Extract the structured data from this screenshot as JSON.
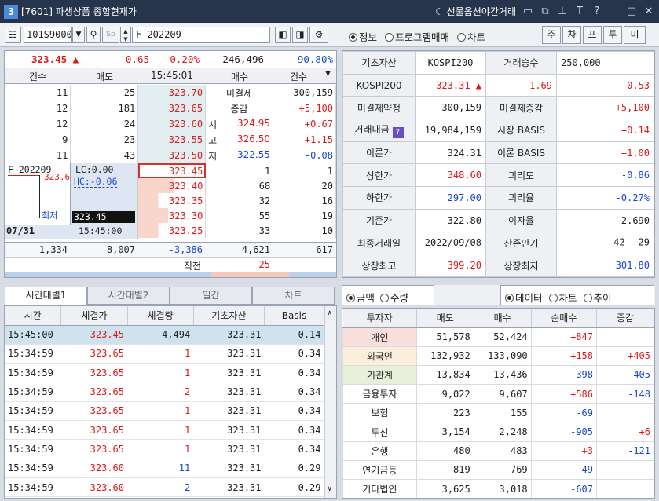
{
  "window": {
    "num": "3",
    "title": "[7601] 파생상품 종합현재가",
    "menu": "선물옵션야간거래"
  },
  "toolbar": {
    "code": "101S9000",
    "name": "F 202209",
    "radio_info": "정보",
    "radio_program": "프로그램매매",
    "radio_chart": "차트",
    "btns": [
      "주",
      "차",
      "프",
      "투",
      "미"
    ]
  },
  "summary": {
    "price": "323.45 ▲",
    "change": "0.65",
    "pct": "0.20%",
    "volume": "246,496",
    "ratio": "90.80%"
  },
  "ob_header": {
    "cnt1": "건수",
    "ask": "매도",
    "time": "15:45:01",
    "bid": "매수",
    "cnt2": "건수"
  },
  "asks": [
    {
      "cnt": "11",
      "qty": "25",
      "price": "323.70"
    },
    {
      "cnt": "12",
      "qty": "181",
      "price": "323.65"
    },
    {
      "cnt": "12",
      "qty": "24",
      "price": "323.60"
    },
    {
      "cnt": "9",
      "qty": "23",
      "price": "323.55"
    },
    {
      "cnt": "11",
      "qty": "43",
      "price": "323.50"
    }
  ],
  "ask_info": [
    {
      "label": "미결제",
      "val": "300,159",
      "chg": ""
    },
    {
      "label": "증감",
      "val": "+5,100",
      "chg": ""
    },
    {
      "label": "시",
      "val": "324.95",
      "chg": "+0.67"
    },
    {
      "label": "고",
      "val": "326.50",
      "chg": "+1.15"
    },
    {
      "label": "저",
      "val": "322.55",
      "chg": "-0.08"
    }
  ],
  "mini": {
    "code": "F 202209",
    "lc": "LC:0.00",
    "hc": "HC:-0.06",
    "last": "323.45",
    "time": "15:45:00",
    "date": "07/31",
    "tag": "최저",
    "hi": "323.6"
  },
  "bids": [
    {
      "price": "323.45",
      "qty": "1",
      "cnt": "1",
      "bar": 0.02
    },
    {
      "price": "323.40",
      "qty": "68",
      "cnt": "20",
      "bar": 0.55
    },
    {
      "price": "323.35",
      "qty": "32",
      "cnt": "16",
      "bar": 0.3
    },
    {
      "price": "323.30",
      "qty": "55",
      "cnt": "19",
      "bar": 0.45
    },
    {
      "price": "323.25",
      "qty": "33",
      "cnt": "10",
      "bar": 0.3
    }
  ],
  "ob_total": {
    "cnt1": "1,334",
    "ask": "8,007",
    "diff": "-3,386",
    "bid": "4,621",
    "cnt2": "617"
  },
  "ob_prev": {
    "label": "직전",
    "val": "25"
  },
  "info": {
    "r1": {
      "l1": "기초자산",
      "v1": "KOSPI200",
      "l2": "거래승수",
      "v2": "250,000"
    },
    "r2": {
      "l1": "KOSPI200",
      "v1": "323.31 ▲",
      "v2": "1.69",
      "v3": "0.53"
    },
    "rows": [
      {
        "l1": "미결제약정",
        "v1": "300,159",
        "l2": "미결제증감",
        "v2": "+5,100"
      },
      {
        "l1": "거래대금",
        "v1": "19,984,159",
        "l2": "시장 BASIS",
        "v2": "+0.14"
      },
      {
        "l1": "이론가",
        "v1": "324.31",
        "l2": "이론 BASIS",
        "v2": "+1.00"
      },
      {
        "l1": "상한가",
        "v1": "348.60",
        "l2": "괴리도",
        "v2": "-0.86"
      },
      {
        "l1": "하한가",
        "v1": "297.00",
        "l2": "괴리율",
        "v2": "-0.27%"
      },
      {
        "l1": "기준가",
        "v1": "322.80",
        "l2": "이자율",
        "v2": "2.690"
      },
      {
        "l1": "최종거래일",
        "v1": "2022/09/08",
        "l2": "잔존만기",
        "v2": "42",
        "v3": "29"
      },
      {
        "l1": "상장최고",
        "v1": "399.20",
        "l2": "상장최저",
        "v2": "301.80"
      }
    ]
  },
  "tabs": [
    "시간대별1",
    "시간대별2",
    "일간",
    "차트"
  ],
  "trades_header": [
    "시간",
    "체결가",
    "체결량",
    "기초자산",
    "Basis"
  ],
  "trades": [
    [
      "15:45:00",
      "323.45",
      "4,494",
      "323.31",
      "0.14"
    ],
    [
      "15:34:59",
      "323.65",
      "1",
      "323.31",
      "0.34"
    ],
    [
      "15:34:59",
      "323.65",
      "1",
      "323.31",
      "0.34"
    ],
    [
      "15:34:59",
      "323.65",
      "2",
      "323.31",
      "0.34"
    ],
    [
      "15:34:59",
      "323.65",
      "1",
      "323.31",
      "0.34"
    ],
    [
      "15:34:59",
      "323.65",
      "1",
      "323.31",
      "0.34"
    ],
    [
      "15:34:59",
      "323.65",
      "1",
      "323.31",
      "0.34"
    ],
    [
      "15:34:59",
      "323.60",
      "11",
      "323.31",
      "0.29"
    ],
    [
      "15:34:59",
      "323.60",
      "2",
      "323.31",
      "0.29"
    ]
  ],
  "inv_opts": {
    "amount": "금액",
    "qty": "수량",
    "data": "데이터",
    "chart": "차트",
    "trend": "추이"
  },
  "inv_header": [
    "투자자",
    "매도",
    "매수",
    "순매수",
    "증감"
  ],
  "investors": [
    [
      "개인",
      "51,578",
      "52,424",
      "+847",
      ""
    ],
    [
      "외국인",
      "132,932",
      "133,090",
      "+158",
      "+405"
    ],
    [
      "기관계",
      "13,834",
      "13,436",
      "-398",
      "-405"
    ],
    [
      "금융투자",
      "9,022",
      "9,607",
      "+586",
      "-148"
    ],
    [
      "보험",
      "223",
      "155",
      "-69",
      ""
    ],
    [
      "투신",
      "3,154",
      "2,248",
      "-905",
      "+6"
    ],
    [
      "은행",
      "480",
      "483",
      "+3",
      "-121"
    ],
    [
      "연기금등",
      "819",
      "769",
      "-49",
      ""
    ],
    [
      "기타법인",
      "3,625",
      "3,018",
      "-607",
      ""
    ]
  ]
}
